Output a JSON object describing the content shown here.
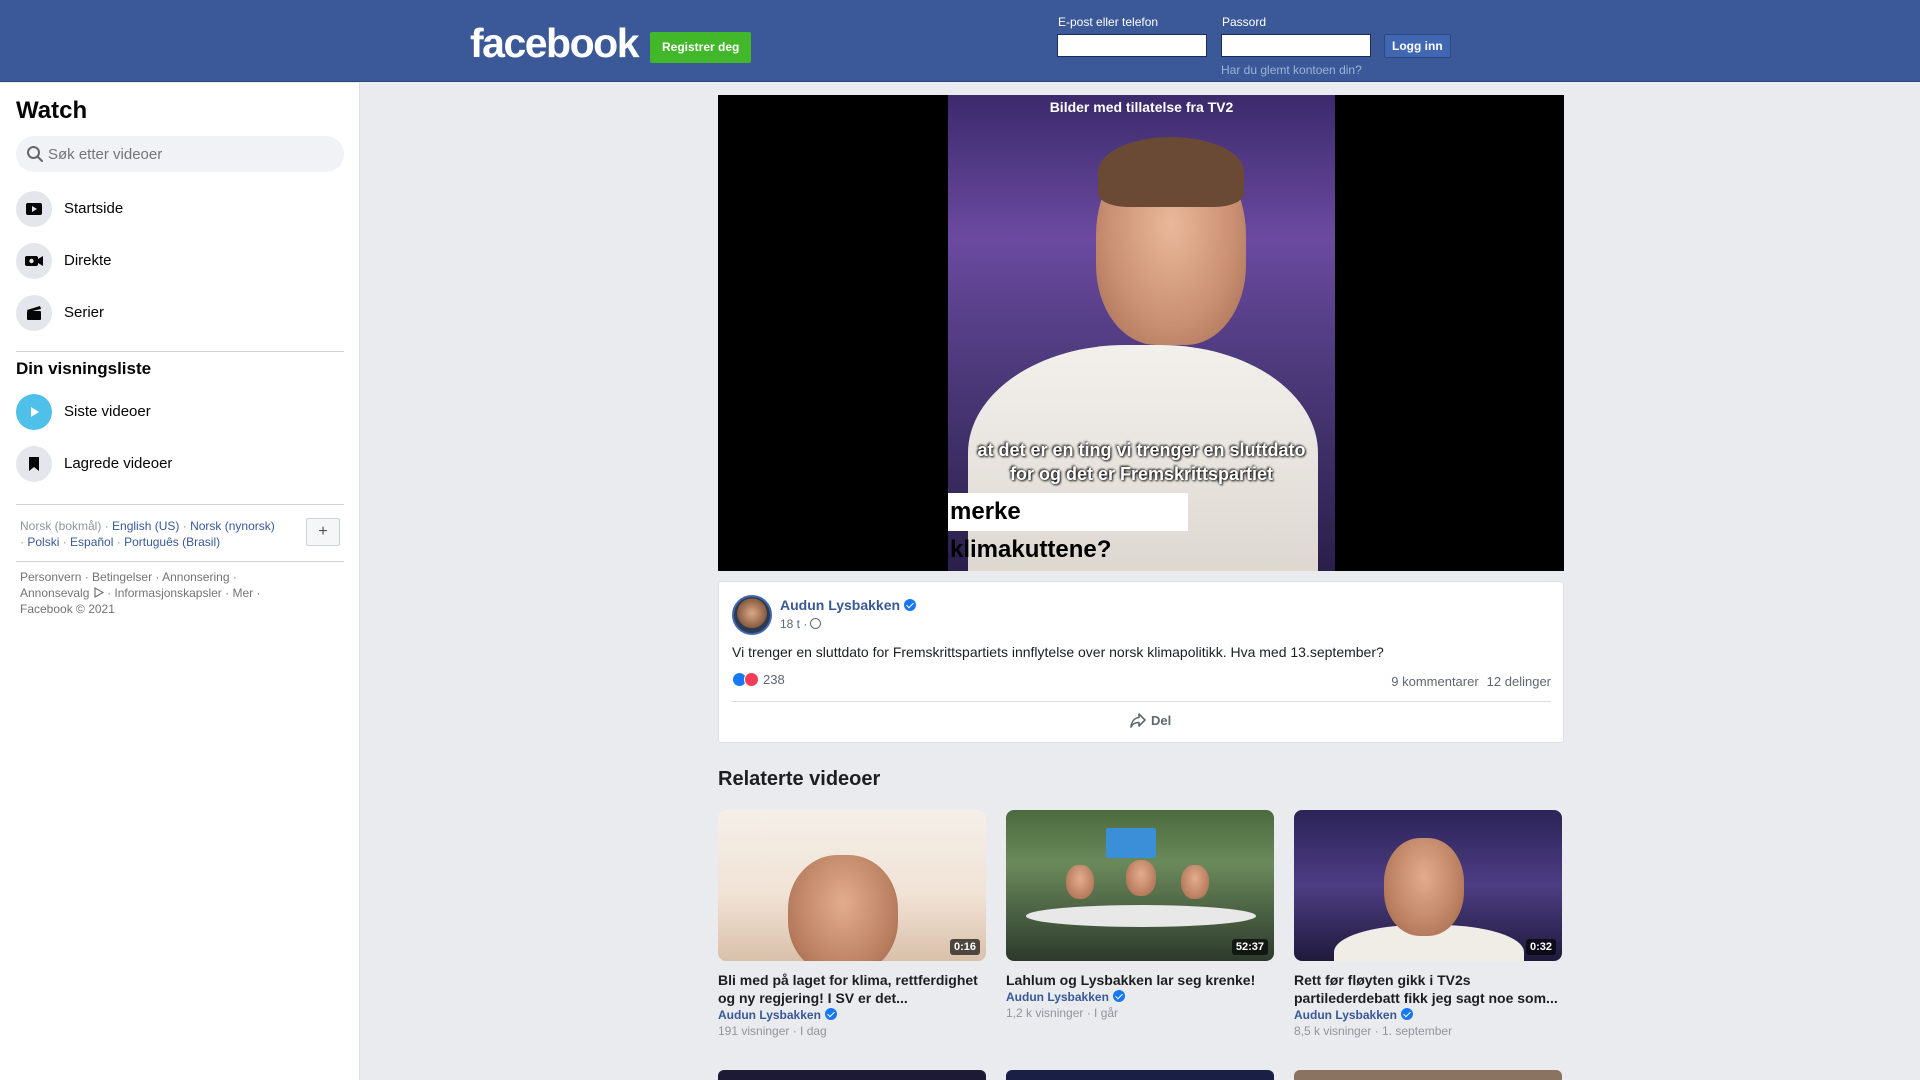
{
  "header": {
    "logo": "facebook",
    "register_label": "Registrer deg",
    "email_label": "E-post eller telefon",
    "email_value": "",
    "password_label": "Passord",
    "password_value": "",
    "login_label": "Logg inn",
    "forgot_label": "Har du glemt kontoen din?"
  },
  "sidebar": {
    "title": "Watch",
    "search_placeholder": "Søk etter videoer",
    "nav": [
      {
        "label": "Startside",
        "icon": "play-screen-icon"
      },
      {
        "label": "Direkte",
        "icon": "live-camera-icon"
      },
      {
        "label": "Serier",
        "icon": "clapperboard-icon"
      }
    ],
    "watchlist_title": "Din visningsliste",
    "watchlist": [
      {
        "label": "Siste videoer",
        "icon": "play-circle-icon"
      },
      {
        "label": "Lagrede videoer",
        "icon": "bookmark-icon"
      }
    ],
    "languages": {
      "current": "Norsk (bokmål)",
      "options": [
        "English (US)",
        "Norsk (nynorsk)",
        "Polski",
        "Español",
        "Português (Brasil)"
      ],
      "more_label": "+"
    },
    "footer": {
      "links": [
        "Personvern",
        "Betingelser",
        "Annonsering",
        "Annonsevalg",
        "Informasjonskapsler",
        "Mer"
      ],
      "copyright": "Facebook © 2021"
    }
  },
  "video": {
    "watermark": "Bilder med tillatelse fra TV2",
    "subtitle_line1": "at det er en ting vi trenger en sluttdato",
    "subtitle_line2": "for og det er Fremskrittspartiet",
    "caption": "merke klimakuttene?"
  },
  "post": {
    "author": "Audun Lysbakken",
    "time": "18 t ·",
    "text": "Vi trenger en sluttdato for Fremskrittspartiets innflytelse over norsk klimapolitikk. Hva med 13.september?",
    "reactions_count": "238",
    "comments": "9 kommentarer",
    "shares": "12 delinger",
    "share_label": "Del"
  },
  "related": {
    "title": "Relaterte videoer",
    "items": [
      {
        "title": "Bli med på laget for klima, rettferdighet og ny regjering! I SV er det...",
        "author": "Audun Lysbakken",
        "meta": "191 visninger · I dag",
        "duration": "0:16"
      },
      {
        "title": "Lahlum og Lysbakken lar seg krenke!",
        "author": "Audun Lysbakken",
        "meta": "1,2 k visninger · I går",
        "duration": "52:37"
      },
      {
        "title": "Rett før fløyten gikk i TV2s partilederdebatt fikk jeg sagt noe som...",
        "author": "Audun Lysbakken",
        "meta": "8,5 k visninger · 1. september",
        "duration": "0:32"
      }
    ]
  },
  "colors": {
    "brand_blue": "#3b5998",
    "register_green": "#42b72a",
    "link_blue": "#385898",
    "verified_blue": "#1877f2"
  }
}
